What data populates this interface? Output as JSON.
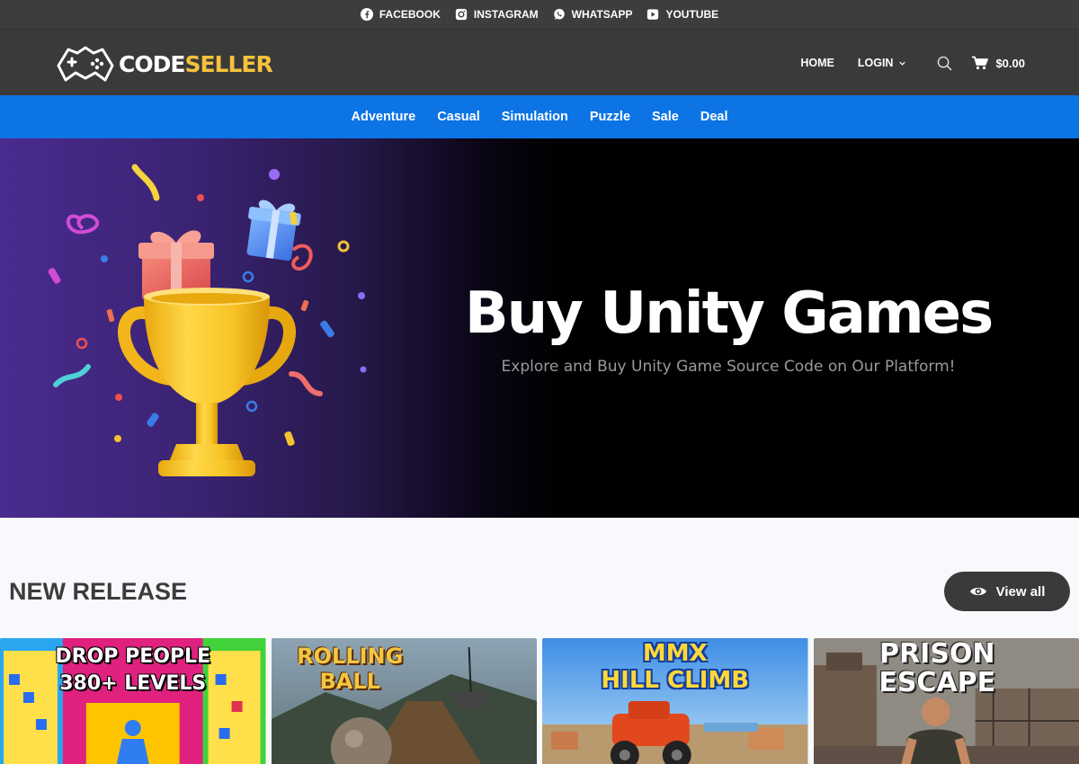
{
  "social": [
    {
      "label": "FACEBOOK",
      "icon": "facebook-icon"
    },
    {
      "label": "INSTAGRAM",
      "icon": "instagram-icon"
    },
    {
      "label": "WHATSAPP",
      "icon": "whatsapp-icon"
    },
    {
      "label": "YOUTUBE",
      "icon": "youtube-icon"
    }
  ],
  "logo": {
    "code": "CODE",
    "seller": "SELLER"
  },
  "nav": {
    "home": "HOME",
    "login": "LOGIN",
    "cart_total": "$0.00"
  },
  "categories": [
    "Adventure",
    "Casual",
    "Simulation",
    "Puzzle",
    "Sale",
    "Deal"
  ],
  "hero": {
    "title": "Buy Unity Games",
    "subtitle": "Explore and Buy Unity Game Source Code on Our Platform!"
  },
  "new_release": {
    "title": "NEW RELEASE",
    "view_all": "View all",
    "cards": [
      {
        "line1": "DROP PEOPLE",
        "line2": "380+ LEVELS"
      },
      {
        "line1": "ROLLING",
        "line2": "BALL"
      },
      {
        "line1": "MMX",
        "line2": "HILL CLIMB"
      },
      {
        "line1": "PRISON",
        "line2": "ESCAPE"
      }
    ]
  },
  "colors": {
    "topbar": "#3d3d3d",
    "header": "#3a3a3a",
    "category_bar": "#0d74e6",
    "logo_accent": "#f6c23b",
    "page_bg": "#f7f9fc"
  }
}
